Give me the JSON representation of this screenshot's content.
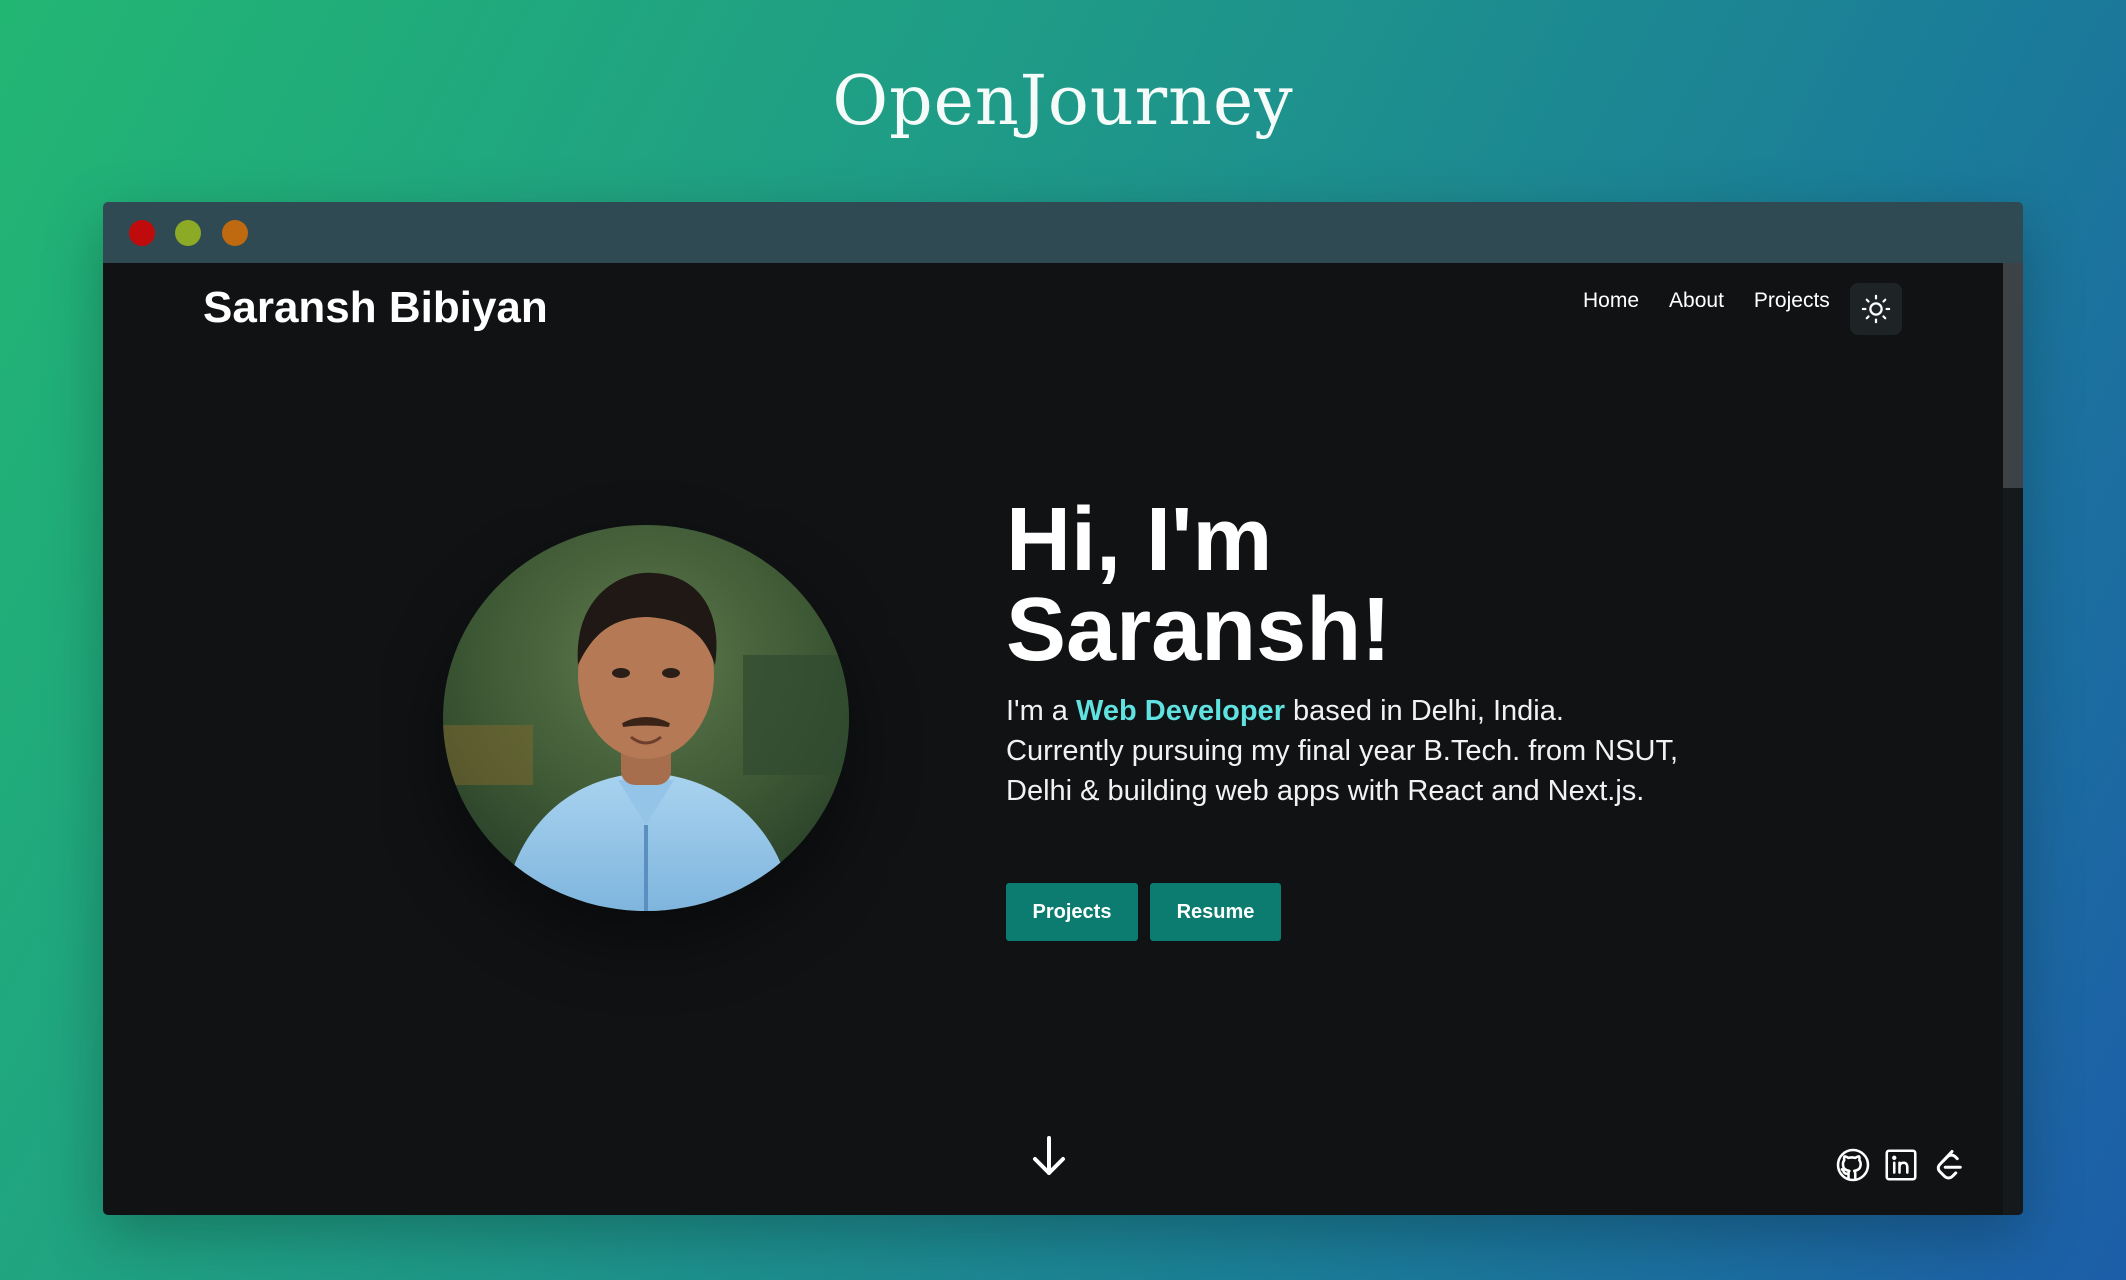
{
  "page": {
    "title": "OpenJourney"
  },
  "window_controls": [
    "close-icon",
    "minimize-icon",
    "zoom-icon"
  ],
  "header": {
    "brand": "Saransh Bibiyan",
    "nav": [
      "Home",
      "About",
      "Projects"
    ],
    "theme_toggle_icon": "sun-icon"
  },
  "hero": {
    "heading_line1": "Hi, I'm",
    "heading_line2": "Saransh!",
    "intro_prefix": "I'm a ",
    "intro_highlight": "Web Developer",
    "intro_suffix": " based in Delhi, India. Currently pursuing my final year B.Tech. from NSUT, Delhi & building web apps with React and Next.js.",
    "buttons": {
      "projects": "Projects",
      "resume": "Resume"
    }
  },
  "footer": {
    "scroll_icon": "arrow-down-icon",
    "social_icons": [
      "github-icon",
      "linkedin-icon",
      "leetcode-icon"
    ]
  },
  "colors": {
    "accent": "#5fe2e0",
    "button": "#0b7c6f",
    "viewport_bg": "#101214",
    "titlebar_bg": "#2f4a53"
  }
}
